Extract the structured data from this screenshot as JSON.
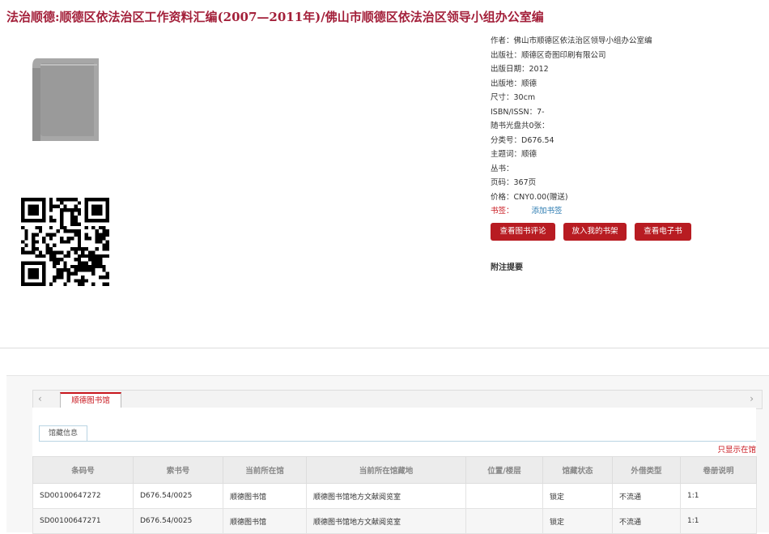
{
  "title": "法治顺德:顺德区依法治区工作资料汇编(2007—2011年)/佛山市顺德区依法治区领导小组办公室编",
  "cover_icon": "book-icon",
  "qr_icon": "qr-code-icon",
  "meta": [
    {
      "label": "作者：",
      "value": "佛山市顺德区依法治区领导小组办公室编"
    },
    {
      "label": "出版社：",
      "value": "顺德区奇图印刷有限公司"
    },
    {
      "label": "出版日期：",
      "value": "2012"
    },
    {
      "label": "出版地：",
      "value": "顺德"
    },
    {
      "label": "尺寸：",
      "value": "30cm"
    },
    {
      "label": "ISBN/ISSN：",
      "value": "7-"
    },
    {
      "label": "随书光盘共0张：",
      "value": ""
    },
    {
      "label": "分类号：",
      "value": "D676.54"
    },
    {
      "label": "主题词：",
      "value": "顺德"
    },
    {
      "label": "丛书：",
      "value": ""
    },
    {
      "label": "页码：",
      "value": "367页"
    },
    {
      "label": "价格：",
      "value": "CNY0.00(赠送)"
    }
  ],
  "tags": {
    "label": "书签：",
    "link": "添加书签"
  },
  "buttons": {
    "review": "查看图书评论",
    "shelf": "放入我的书架",
    "ebook": "查看电子书"
  },
  "notes_title": "附注提要",
  "holdings": {
    "tab_library": "顺德图书馆",
    "subtab": "馆藏信息",
    "only_this": "只显示在馆",
    "headers": [
      "条码号",
      "索书号",
      "当前所在馆",
      "当前所在馆藏地",
      "位置/楼层",
      "馆藏状态",
      "外借类型",
      "卷册说明"
    ],
    "rows": [
      [
        "SD00100647272",
        "D676.54/0025",
        "顺德图书馆",
        "顺德图书馆地方文献阅览室",
        "",
        "锁定",
        "不流通",
        "1:1"
      ],
      [
        "SD00100647271",
        "D676.54/0025",
        "顺德图书馆",
        "顺德图书馆地方文献阅览室",
        "",
        "锁定",
        "不流通",
        "1:1"
      ]
    ]
  }
}
